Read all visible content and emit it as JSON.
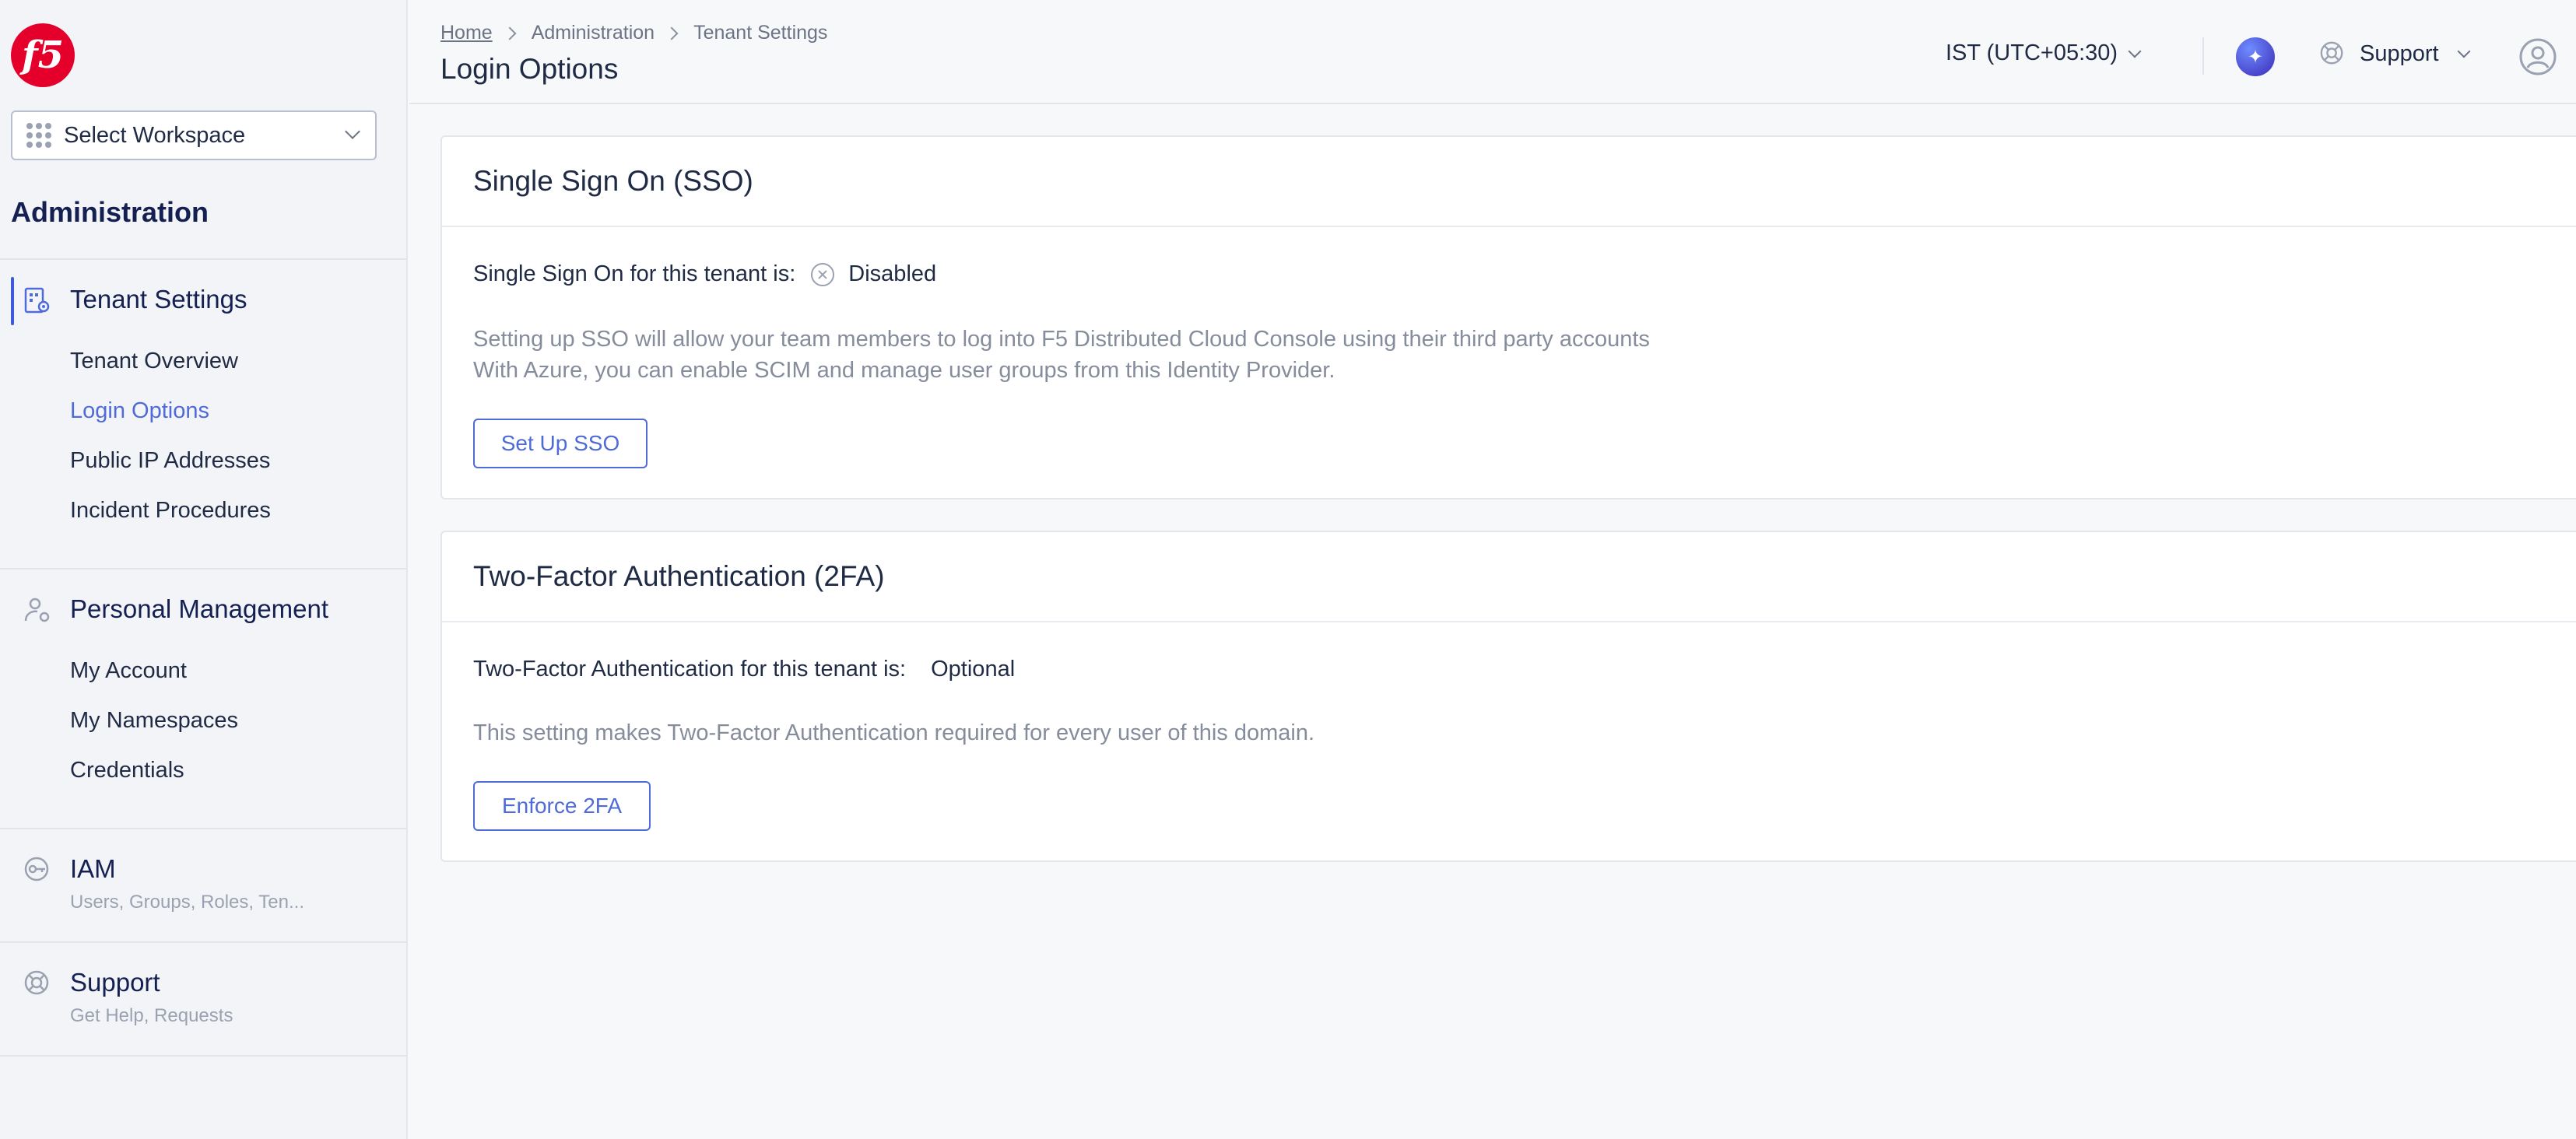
{
  "brand": {
    "logo_text": "f5",
    "accent": "#4f6bd8",
    "logo_color": "#e4002b"
  },
  "workspace": {
    "label": "Select Workspace"
  },
  "sidebar": {
    "heading": "Administration",
    "groups": [
      {
        "title": "Tenant Settings",
        "icon": "tenant-settings-icon",
        "items": [
          "Tenant Overview",
          "Login Options",
          "Public IP Addresses",
          "Incident Procedures"
        ]
      },
      {
        "title": "Personal Management",
        "icon": "personal-management-icon",
        "items": [
          "My Account",
          "My Namespaces",
          "Credentials"
        ]
      },
      {
        "title": "IAM",
        "subtitle": "Users, Groups, Roles, Ten...",
        "icon": "key-icon"
      },
      {
        "title": "Support",
        "subtitle": "Get Help, Requests",
        "icon": "lifebuoy-icon"
      }
    ],
    "active_item": "Login Options"
  },
  "header": {
    "breadcrumbs": [
      "Home",
      "Administration",
      "Tenant Settings"
    ],
    "title": "Login Options",
    "timezone": "IST (UTC+05:30)",
    "support_label": "Support"
  },
  "sso": {
    "title": "Single Sign On (SSO)",
    "status_label": "Single Sign On for this tenant is:",
    "status_value": "Disabled",
    "desc_line1": "Setting up SSO will allow your team members to log into F5 Distributed Cloud Console using their third party accounts",
    "desc_line2": "With Azure, you can enable SCIM and manage user groups from this Identity Provider.",
    "button": "Set Up SSO"
  },
  "tfa": {
    "title": "Two-Factor Authentication (2FA)",
    "status_label": "Two-Factor Authentication for this tenant is:",
    "status_value": "Optional",
    "desc": "This setting makes Two-Factor Authentication required for every user of this domain.",
    "button": "Enforce 2FA"
  }
}
